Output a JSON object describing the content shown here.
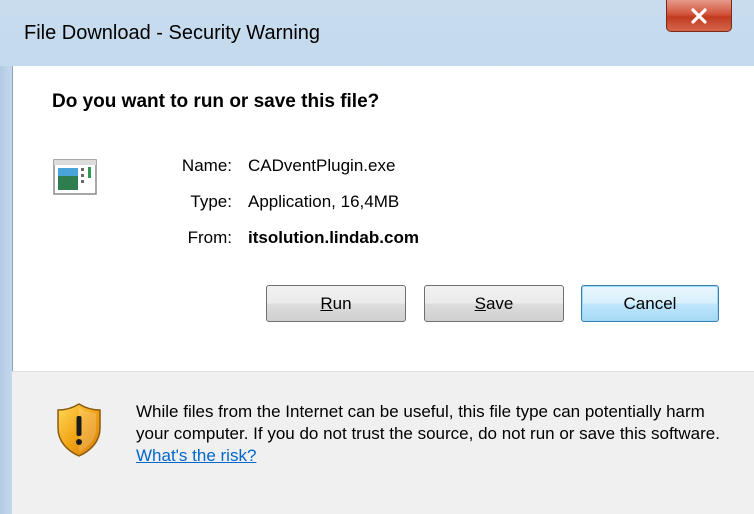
{
  "window": {
    "title": "File Download - Security Warning"
  },
  "dialog": {
    "question": "Do you want to run or save this file?",
    "fields": {
      "name_label": "Name:",
      "name_value": "CADventPlugin.exe",
      "type_label": "Type:",
      "type_value": "Application, 16,4MB",
      "from_label": "From:",
      "from_value": "itsolution.lindab.com"
    },
    "buttons": {
      "run_mnemonic": "R",
      "run_rest": "un",
      "save_mnemonic": "S",
      "save_rest": "ave",
      "cancel": "Cancel"
    },
    "warning": {
      "text": "While files from the Internet can be useful, this file type can potentially harm your computer. If you do not trust the source, do not run or save this software.",
      "link": "What's the risk?"
    }
  },
  "icons": {
    "close": "close-icon",
    "file": "application-file-icon",
    "shield": "security-shield-icon"
  },
  "colors": {
    "close_button": "#c8462a",
    "link": "#0066cc",
    "default_button_border": "#3c7fb1"
  }
}
